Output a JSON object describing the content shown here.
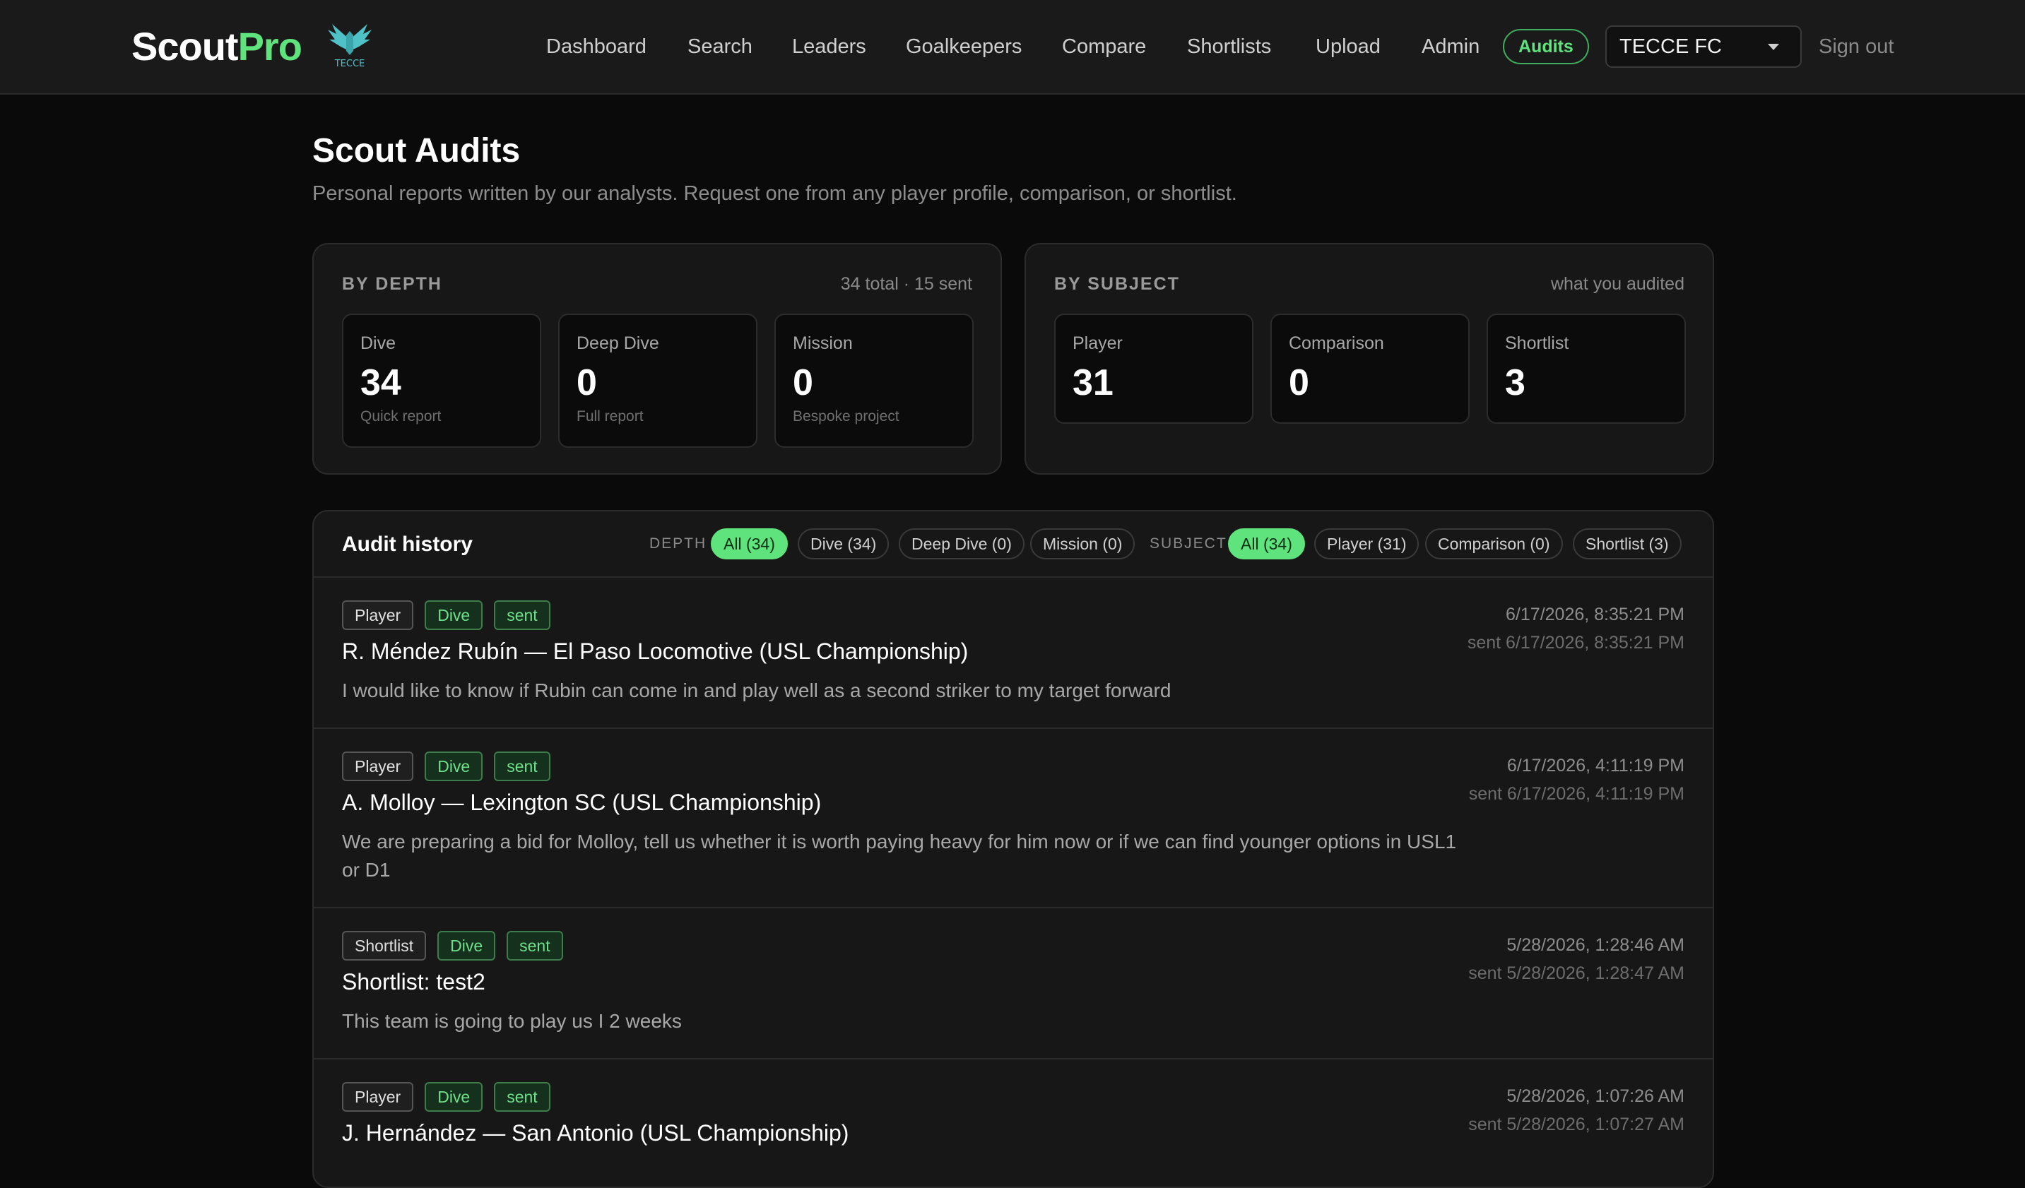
{
  "header": {
    "brand_scout": "Scout",
    "brand_pro": "Pro",
    "crest_text": "TECCE",
    "nav": [
      "Dashboard",
      "Search",
      "Leaders",
      "Goalkeepers",
      "Compare",
      "Shortlists",
      "Upload",
      "Admin"
    ],
    "audits_label": "Audits",
    "club_selected": "TECCE FC",
    "signout": "Sign out"
  },
  "page": {
    "title": "Scout Audits",
    "subtitle": "Personal reports written by our analysts. Request one from any player profile, comparison, or shortlist."
  },
  "by_depth": {
    "label": "BY DEPTH",
    "meta": "34 total · 15 sent",
    "stats": [
      {
        "name": "Dive",
        "value": "34",
        "desc": "Quick report"
      },
      {
        "name": "Deep Dive",
        "value": "0",
        "desc": "Full report"
      },
      {
        "name": "Mission",
        "value": "0",
        "desc": "Bespoke project"
      }
    ]
  },
  "by_subject": {
    "label": "BY SUBJECT",
    "meta": "what you audited",
    "stats": [
      {
        "name": "Player",
        "value": "31"
      },
      {
        "name": "Comparison",
        "value": "0"
      },
      {
        "name": "Shortlist",
        "value": "3"
      }
    ]
  },
  "history": {
    "title": "Audit history",
    "depth_label": "DEPTH",
    "depth_filters": [
      "All (34)",
      "Dive (34)",
      "Deep Dive (0)",
      "Mission (0)"
    ],
    "subject_label": "SUBJECT",
    "subject_filters": [
      "All (34)",
      "Player (31)",
      "Comparison (0)",
      "Shortlist (3)"
    ],
    "rows": [
      {
        "subject": "Player",
        "depth": "Dive",
        "status": "sent",
        "title": "R. Méndez Rubín — El Paso Locomotive (USL Championship)",
        "body": "I would like to know if Rubin can come in and play well as a second striker to my target forward",
        "created": "6/17/2026, 8:35:21 PM",
        "sent": "sent 6/17/2026, 8:35:21 PM"
      },
      {
        "subject": "Player",
        "depth": "Dive",
        "status": "sent",
        "title": "A. Molloy — Lexington SC (USL Championship)",
        "body": "We are preparing a bid for Molloy, tell us whether it is worth paying heavy for him now or if we can find younger options in USL1 or D1",
        "created": "6/17/2026, 4:11:19 PM",
        "sent": "sent 6/17/2026, 4:11:19 PM"
      },
      {
        "subject": "Shortlist",
        "depth": "Dive",
        "status": "sent",
        "title": "Shortlist: test2",
        "body": "This team is going to play us I 2 weeks",
        "created": "5/28/2026, 1:28:46 AM",
        "sent": "sent 5/28/2026, 1:28:47 AM"
      },
      {
        "subject": "Player",
        "depth": "Dive",
        "status": "sent",
        "title": "J. Hernández — San Antonio (USL Championship)",
        "body": "",
        "created": "5/28/2026, 1:07:26 AM",
        "sent": "sent 5/28/2026, 1:07:27 AM"
      }
    ]
  },
  "colors": {
    "accent": "#5ee37d",
    "background": "#0a0a0a",
    "panel": "#171717"
  }
}
